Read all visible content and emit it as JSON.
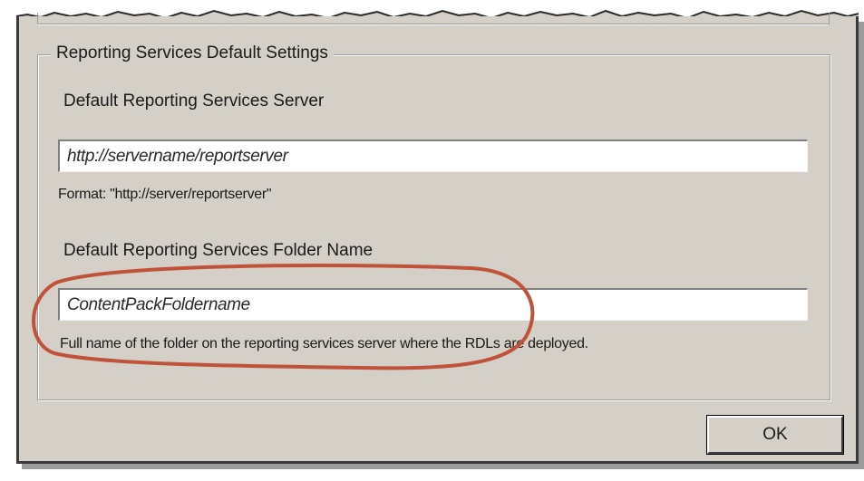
{
  "dialog": {
    "group_title": "Reporting Services Default Settings",
    "server": {
      "label": "Default Reporting Services Server",
      "value": "http://servername/reportserver",
      "hint": "Format: \"http://server/reportserver\""
    },
    "folder": {
      "label": "Default Reporting Services Folder Name",
      "value": "ContentPackFoldername",
      "hint": "Full name of the folder on the reporting services server where the RDLs are deployed."
    },
    "ok_label": "OK"
  },
  "annotation": {
    "highlight_color": "#c0523a"
  }
}
